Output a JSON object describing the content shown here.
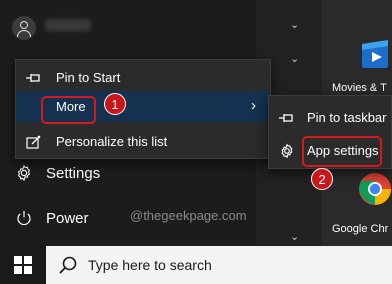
{
  "start_menu": {
    "rail": {
      "settings_label": "Settings",
      "power_label": "Power"
    }
  },
  "context_menu": {
    "items": [
      {
        "label": "Pin to Start",
        "icon": "pin-icon"
      },
      {
        "label": "More",
        "icon": "",
        "submenu": true
      },
      {
        "label": "Personalize this list",
        "icon": "personalize-icon"
      }
    ]
  },
  "submenu": {
    "items": [
      {
        "label": "Pin to taskbar",
        "icon": "pin-icon"
      },
      {
        "label": "App settings",
        "icon": "gear-icon"
      }
    ]
  },
  "tiles": [
    {
      "label": "Movies & T"
    },
    {
      "label": "Google Chr"
    }
  ],
  "annotations": {
    "badge1": "1",
    "badge2": "2"
  },
  "watermark": "@thegeekpage.com",
  "taskbar": {
    "search_placeholder": "Type here to search"
  },
  "colors": {
    "highlight": "#15314f",
    "annotation_red": "#d41a1a",
    "menu_bg": "#2b2b2b"
  }
}
